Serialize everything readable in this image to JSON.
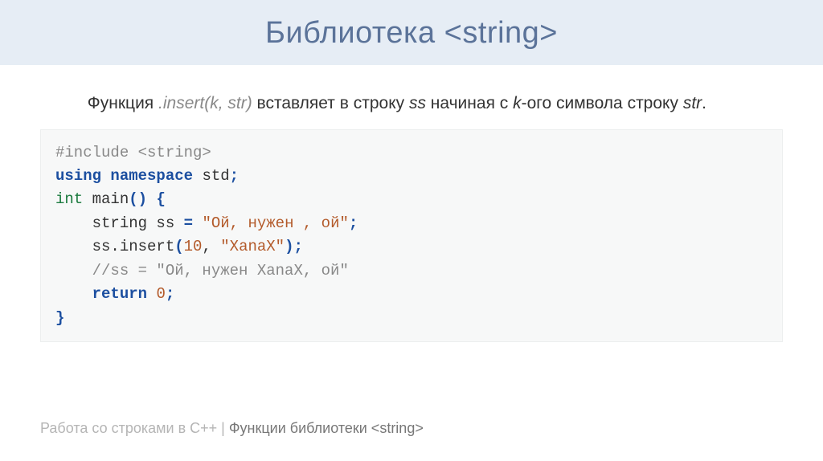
{
  "title": "Библиотека <string>",
  "desc": {
    "t1": "Функция ",
    "func": ".insert(k, str)",
    "t2": " вставляет в строку ",
    "var_ss": "ss",
    "t3": " начиная с ",
    "var_k": "k",
    "t4": "-ого символа строку ",
    "var_str": "str",
    "t5": "."
  },
  "code": {
    "l1_include": "#include <string>",
    "l2_using": "using",
    "l2_namespace": "namespace",
    "l2_std": " std",
    "l2_semi": ";",
    "l3_int": "int",
    "l3_main": " main",
    "l3_paren": "()",
    "l3_open": " {",
    "l4_indent": "    ",
    "l4_decl": "string ss ",
    "l4_eq": "=",
    "l4_sp": " ",
    "l4_str": "\"Ой, нужен , ой\"",
    "l4_semi": ";",
    "l5_indent": "    ",
    "l5_call": "ss.insert",
    "l5_lp": "(",
    "l5_num": "10",
    "l5_comma": ", ",
    "l5_str": "\"XanaX\"",
    "l5_rp": ")",
    "l5_semi": ";",
    "l6_indent": "    ",
    "l6_cmt": "//ss = \"Ой, нужен XanaX, ой\"",
    "l7_indent": "    ",
    "l7_return": "return",
    "l7_sp": " ",
    "l7_zero": "0",
    "l7_semi": ";",
    "l8_close": "}"
  },
  "footer": {
    "light": "Работа со строками в C++ | ",
    "dark": "Функции библиотеки <string>"
  }
}
